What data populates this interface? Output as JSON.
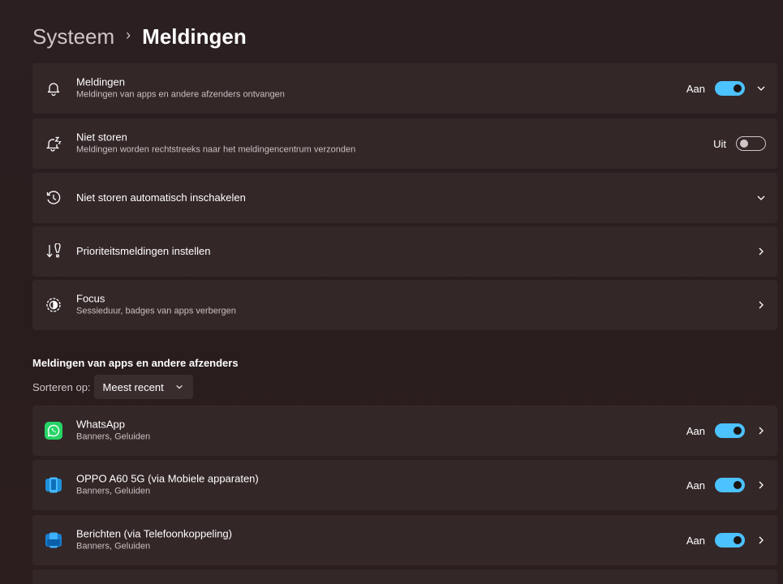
{
  "breadcrumb": {
    "parent": "Systeem",
    "separator": "›",
    "current": "Meldingen"
  },
  "settings": [
    {
      "id": "meldingen",
      "title": "Meldingen",
      "subtitle": "Meldingen van apps en andere afzenders ontvangen",
      "state_label": "Aan",
      "toggle": "on",
      "chevron": "down",
      "icon": "bell-icon"
    },
    {
      "id": "niet-storen",
      "title": "Niet storen",
      "subtitle": "Meldingen worden rechtstreeks naar het meldingencentrum verzonden",
      "state_label": "Uit",
      "toggle": "off",
      "chevron": "none",
      "icon": "bell-snooze-icon"
    },
    {
      "id": "niet-storen-auto",
      "title": "Niet storen automatisch inschakelen",
      "subtitle": "",
      "chevron": "down",
      "icon": "clock-icon"
    },
    {
      "id": "prioriteit",
      "title": "Prioriteitsmeldingen instellen",
      "subtitle": "",
      "chevron": "right",
      "icon": "priority-icon"
    },
    {
      "id": "focus",
      "title": "Focus",
      "subtitle": "Sessieduur, badges van apps verbergen",
      "chevron": "right",
      "icon": "focus-icon"
    }
  ],
  "apps_section": {
    "title": "Meldingen van apps en andere afzenders",
    "sort_label": "Sorteren op:",
    "sort_value": "Meest recent"
  },
  "apps": [
    {
      "id": "whatsapp",
      "title": "WhatsApp",
      "subtitle": "Banners, Geluiden",
      "state_label": "Aan",
      "toggle": "on",
      "icon": "whatsapp-icon"
    },
    {
      "id": "oppo",
      "title": "OPPO A60 5G (via Mobiele apparaten)",
      "subtitle": "Banners, Geluiden",
      "state_label": "Aan",
      "toggle": "on",
      "icon": "mobile-devices-icon"
    },
    {
      "id": "berichten",
      "title": "Berichten (via Telefoonkoppeling)",
      "subtitle": "Banners, Geluiden",
      "state_label": "Aan",
      "toggle": "on",
      "icon": "phone-link-icon"
    }
  ],
  "colors": {
    "accent": "#4cc2ff",
    "card": "#342728",
    "background": "#2a1e1f",
    "whatsapp": "#25d366"
  }
}
